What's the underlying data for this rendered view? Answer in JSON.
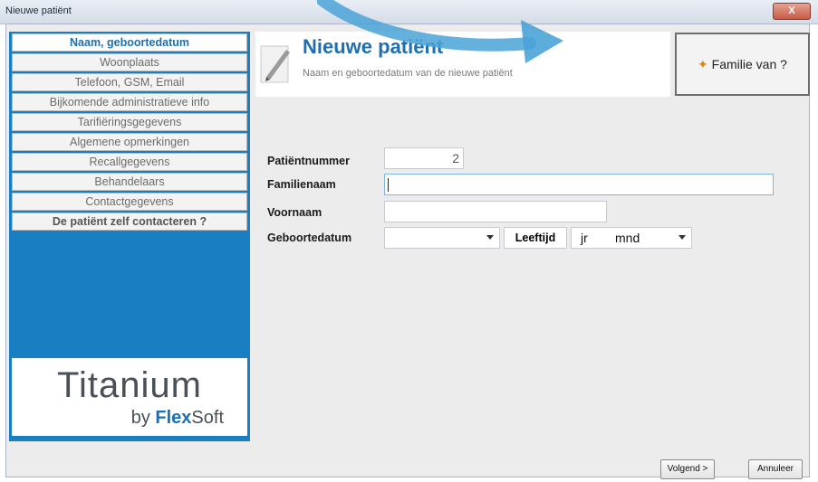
{
  "window": {
    "title": "Nieuwe patiënt",
    "close_label": "X"
  },
  "nav": {
    "items": [
      {
        "label": "Naam, geboortedatum",
        "state": "active"
      },
      {
        "label": "Woonplaats",
        "state": "normal"
      },
      {
        "label": "Telefoon, GSM, Email",
        "state": "normal"
      },
      {
        "label": "Bijkomende administratieve info",
        "state": "normal"
      },
      {
        "label": "Tarifiëringsgegevens",
        "state": "normal"
      },
      {
        "label": "Algemene opmerkingen",
        "state": "normal"
      },
      {
        "label": "Recallgegevens",
        "state": "normal"
      },
      {
        "label": "Behandelaars",
        "state": "normal"
      },
      {
        "label": "Contactgegevens",
        "state": "normal"
      },
      {
        "label": "De patiënt zelf contacteren ?",
        "state": "bold"
      }
    ]
  },
  "logo": {
    "main": "Titanium",
    "by": "by ",
    "brand1": "Flex",
    "brand2": "Soft"
  },
  "header": {
    "title": "Nieuwe patiënt",
    "subtitle": "Naam en geboortedatum van de nieuwe patiënt"
  },
  "familie_button": {
    "label": "Familie van ?"
  },
  "form": {
    "patientnummer_label": "Patiëntnummer",
    "patientnummer_value": "2",
    "familienaam_label": "Familienaam",
    "familienaam_value": "",
    "voornaam_label": "Voornaam",
    "voornaam_value": "",
    "geboortedatum_label": "Geboortedatum",
    "geboortedatum_value": "",
    "leeftijd_label": "Leeftijd",
    "leeftijd_jr": "jr",
    "leeftijd_mnd": "mnd"
  },
  "footer": {
    "next_label": "Volgend >",
    "cancel_label": "Annuleer"
  },
  "colors": {
    "sidebar": "#1a7fc2",
    "accent_title": "#1f6fb0",
    "annotation_arrow": "#4aa3d8"
  }
}
